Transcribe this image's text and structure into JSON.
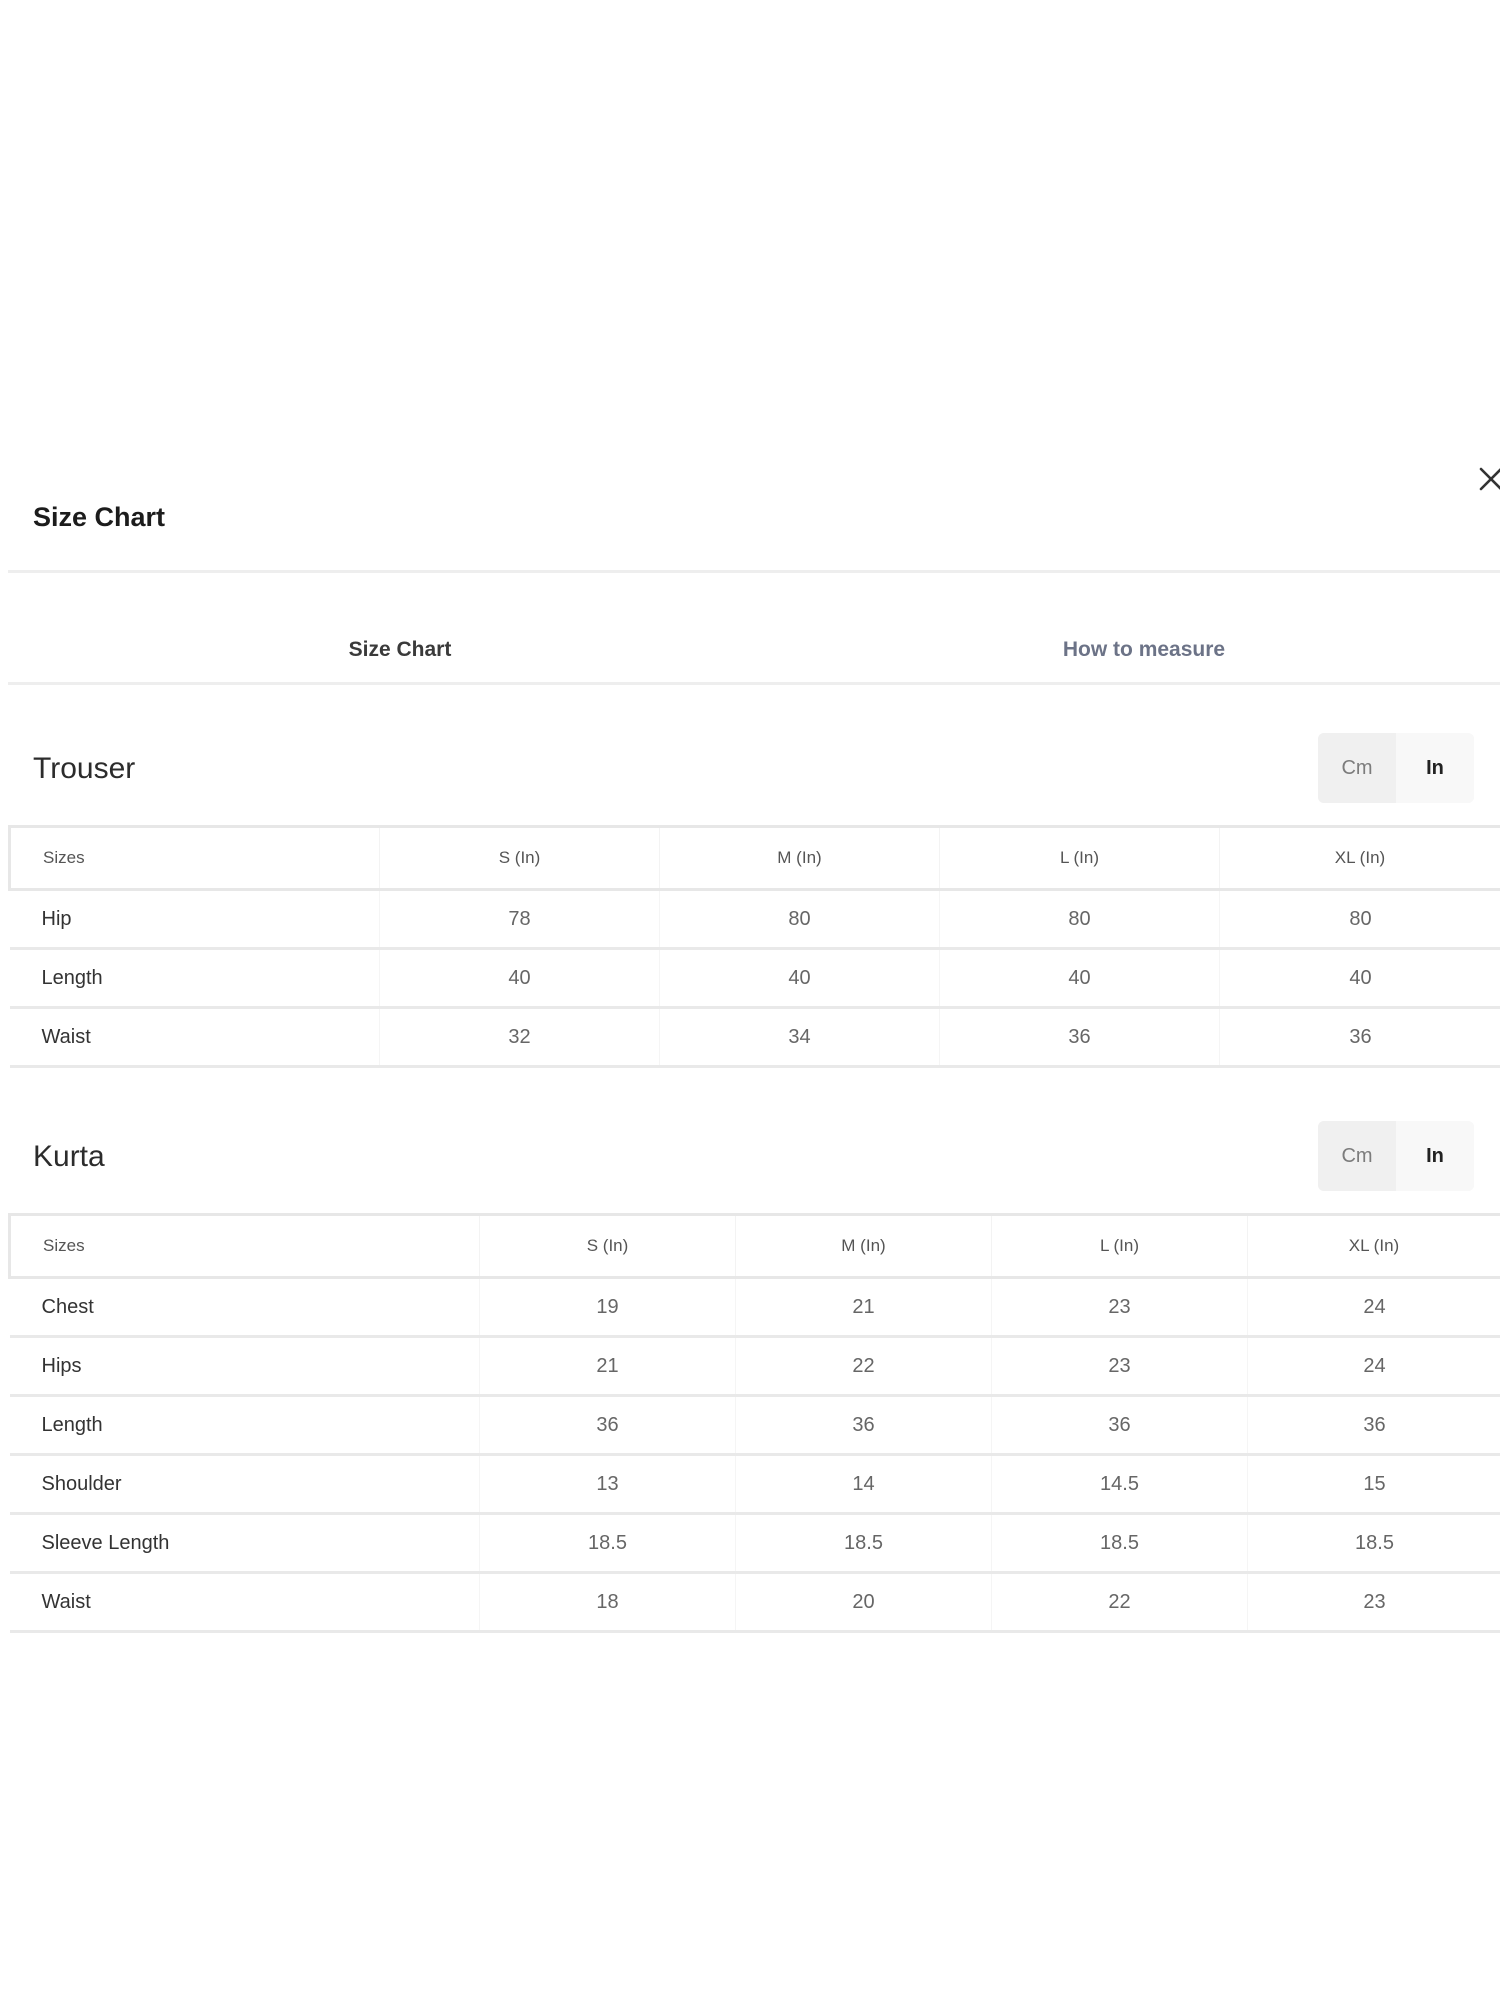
{
  "modal": {
    "title": "Size Chart",
    "close_icon": "close-icon"
  },
  "tabs": [
    {
      "label": "Size Chart",
      "active": true
    },
    {
      "label": "How to measure",
      "active": false
    }
  ],
  "sections": [
    {
      "title": "Trouser",
      "unit_options": [
        "Cm",
        "In"
      ],
      "selected_unit": "In",
      "headers": [
        "Sizes",
        "S (In)",
        "M (In)",
        "L (In)",
        "XL (In)"
      ],
      "rows": [
        [
          "Hip",
          "78",
          "80",
          "80",
          "80"
        ],
        [
          "Length",
          "40",
          "40",
          "40",
          "40"
        ],
        [
          "Waist",
          "32",
          "34",
          "36",
          "36"
        ]
      ]
    },
    {
      "title": "Kurta",
      "unit_options": [
        "Cm",
        "In"
      ],
      "selected_unit": "In",
      "headers": [
        "Sizes",
        "S (In)",
        "M (In)",
        "L (In)",
        "XL (In)"
      ],
      "rows": [
        [
          "Chest",
          "19",
          "21",
          "23",
          "24"
        ],
        [
          "Hips",
          "21",
          "22",
          "23",
          "24"
        ],
        [
          "Length",
          "36",
          "36",
          "36",
          "36"
        ],
        [
          "Shoulder",
          "13",
          "14",
          "14.5",
          "15"
        ],
        [
          "Sleeve Length",
          "18.5",
          "18.5",
          "18.5",
          "18.5"
        ],
        [
          "Waist",
          "18",
          "20",
          "22",
          "23"
        ]
      ]
    }
  ]
}
